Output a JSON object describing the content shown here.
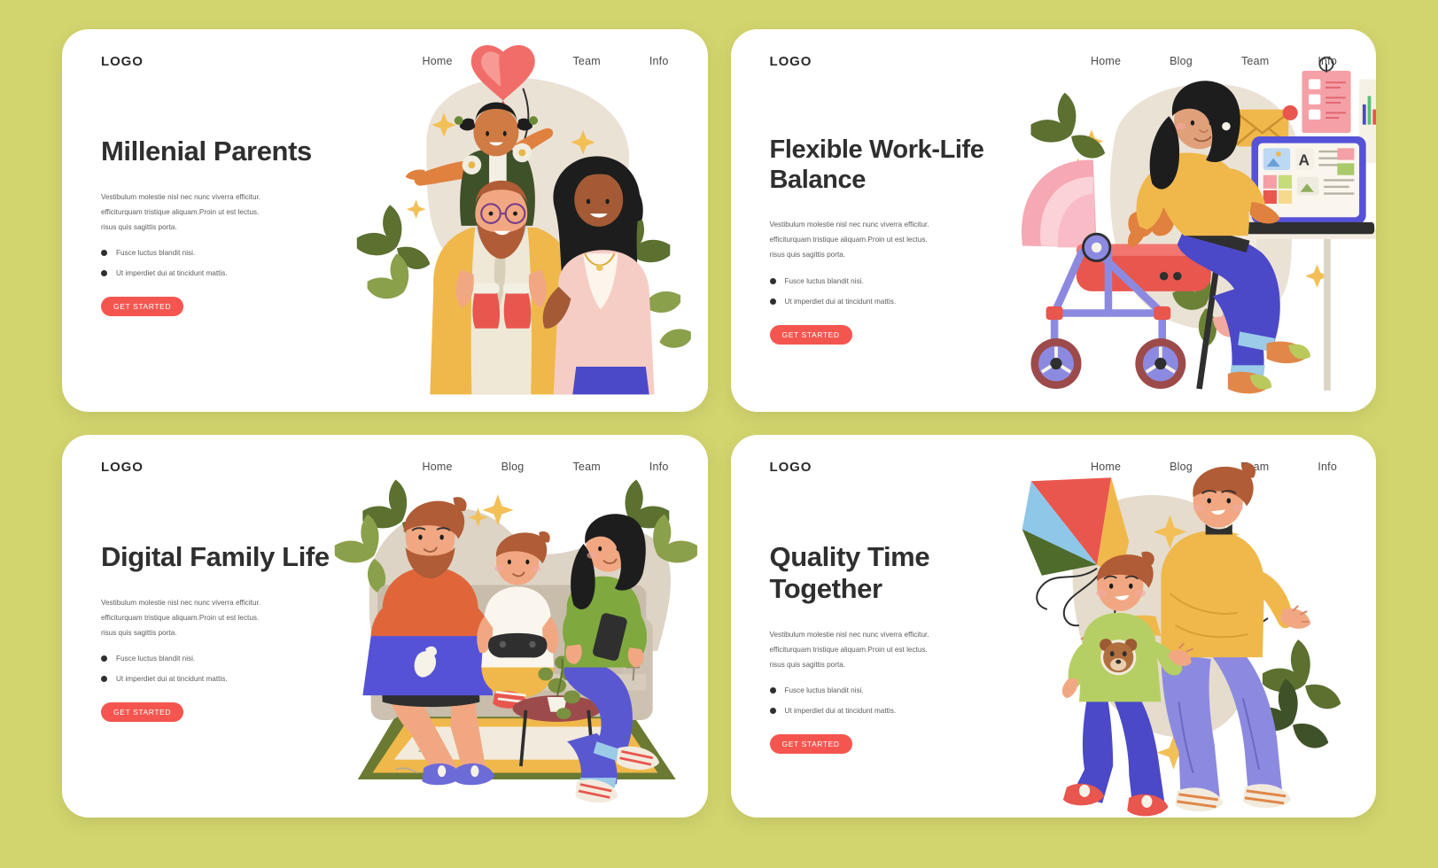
{
  "background_color": "#d2d46e",
  "accent_color": "#f4564f",
  "card_color": "#ffffff",
  "heading_color": "#2f2f2f",
  "common": {
    "logo": "LOGO",
    "nav": [
      "Home",
      "Blog",
      "Team",
      "Info"
    ],
    "paragraph": "Vestibulum molestie nisl nec nunc viverra efficitur. efficiturquam tristique aliquam.Proin ut est lectus. risus quis sagittis porta.",
    "bullets": [
      "Fusce luctus blandit nisi.",
      "Ut imperdiet dui at tincidunt mattis."
    ],
    "cta_label": "GET STARTED"
  },
  "cards": [
    {
      "id": "millenial-parents",
      "headline": "Millenial Parents",
      "illustration": "family-with-child-on-shoulders-holding-heart-balloon"
    },
    {
      "id": "flexible-work-life-balance",
      "headline": "Flexible Work-Life Balance",
      "illustration": "mother-working-at-desk-with-laptop-beside-pram"
    },
    {
      "id": "digital-family-life",
      "headline": "Digital Family Life",
      "illustration": "family-on-sofa-with-laptop-gamepad-and-phone"
    },
    {
      "id": "quality-time-together",
      "headline": "Quality Time Together",
      "illustration": "father-and-son-flying-a-kite"
    }
  ]
}
